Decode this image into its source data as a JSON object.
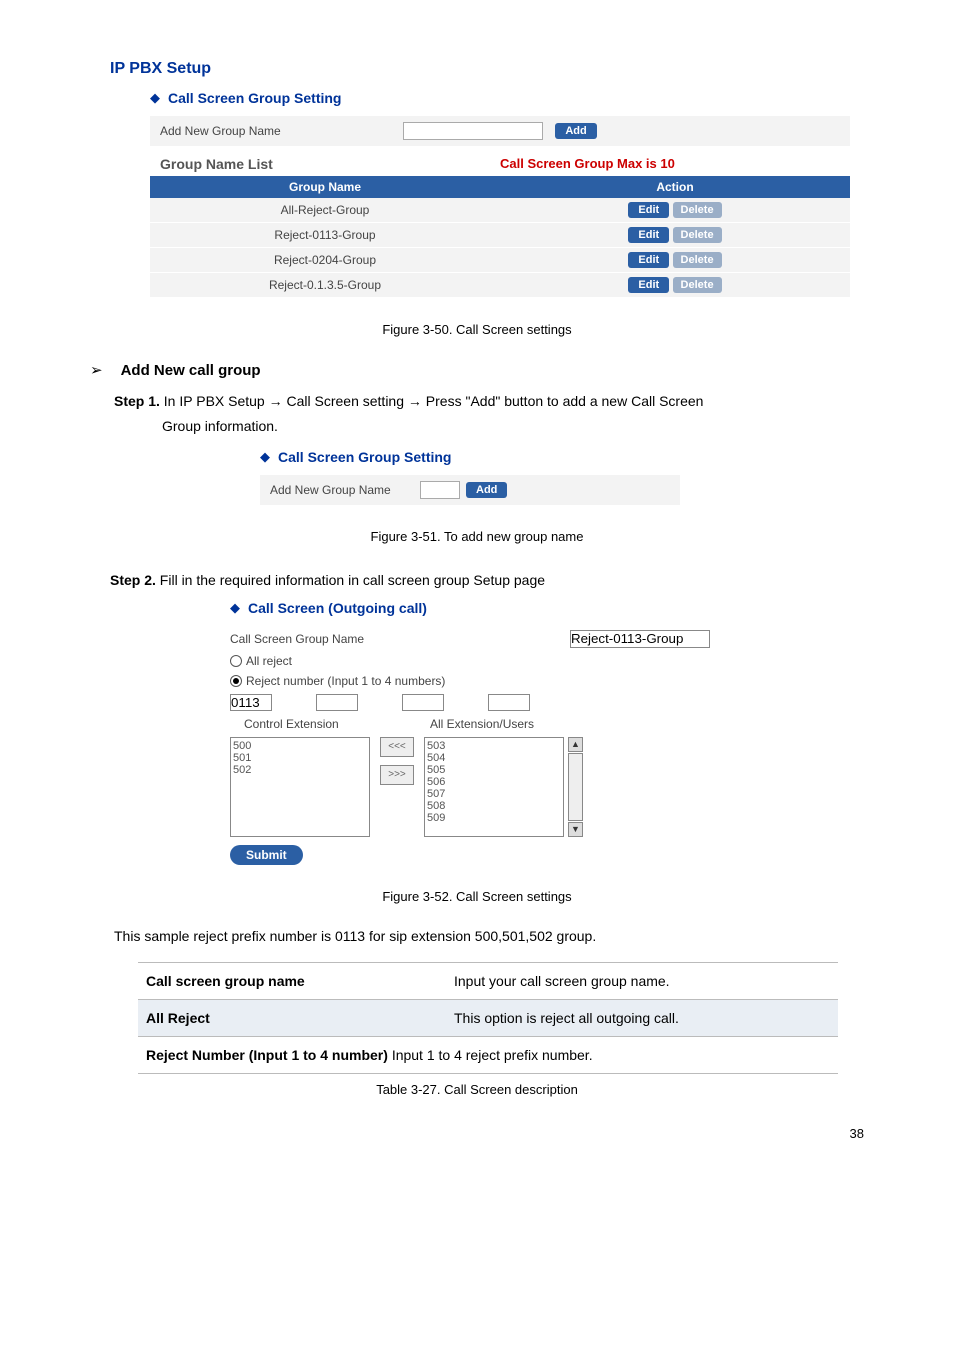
{
  "top": {
    "title": "IP PBX Setup",
    "sub": "Call Screen Group Setting",
    "add_label": "Add New Group Name",
    "add_btn": "Add",
    "list_left": "Group Name List",
    "list_right": "Call Screen Group Max is 10",
    "th_group": "Group Name",
    "th_action": "Action",
    "rows": [
      {
        "name": "All-Reject-Group",
        "edit": "Edit",
        "del": "Delete"
      },
      {
        "name": "Reject-0113-Group",
        "edit": "Edit",
        "del": "Delete"
      },
      {
        "name": "Reject-0204-Group",
        "edit": "Edit",
        "del": "Delete"
      },
      {
        "name": "Reject-0.1.3.5-Group",
        "edit": "Edit",
        "del": "Delete"
      }
    ],
    "caption": "Figure 3-50. Call Screen settings"
  },
  "sec1": {
    "arrow": "➢",
    "heading": "Add New call group",
    "step1_a": "Step 1.",
    "step1_b": " In IP PBX Setup ",
    "step1_c": " Call Screen setting ",
    "step1_d": " Press \"Add\" button to add a new Call Screen",
    "step1_e": "Group information.",
    "arrowch": "→",
    "sub": "Call Screen Group Setting",
    "add_label": "Add New Group Name",
    "add_btn": "Add",
    "caption": "Figure 3-51. To add new group name"
  },
  "sec2": {
    "step2_a": "Step 2.",
    "step2_b": " Fill in the required information in call screen group Setup page",
    "sub": "Call Screen (Outgoing call)",
    "name_label": "Call Screen Group Name",
    "name_value": "Reject-0113-Group",
    "opt_all": "All reject",
    "opt_rej": "Reject number (Input 1 to 4 numbers)",
    "num1": "0113",
    "ctrl_label": "Control Extension",
    "all_label": "All Extension/Users",
    "left_items": "500\n501\n502",
    "right_items": "503\n504\n505\n506\n507\n508\n509",
    "move_left": "<<<",
    "move_right": ">>>",
    "up": "▲",
    "down": "▼",
    "submit": "Submit",
    "caption": "Figure 3-52. Call Screen settings"
  },
  "sample": "This sample reject prefix number is 0113 for sip extension 500,501,502 group.",
  "desc": {
    "r1k": "Call screen group name",
    "r1v": "Input your call screen group name.",
    "r2k": "All Reject",
    "r2v": "This option is reject all outgoing call.",
    "r3k": "Reject Number (Input 1 to 4 number) ",
    "r3v": "Input 1 to 4 reject prefix number.",
    "caption": "Table 3-27. Call Screen description"
  },
  "pagenum": "38"
}
